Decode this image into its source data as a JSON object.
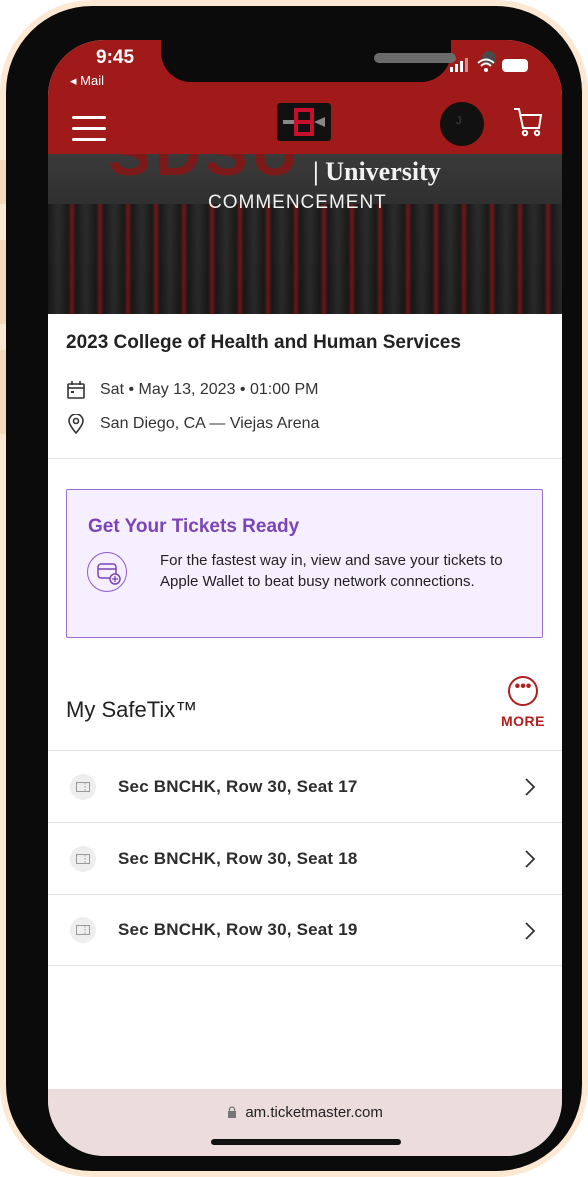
{
  "status": {
    "time": "9:45",
    "back_app": "◂ Mail"
  },
  "header": {
    "avatar_initial": "J"
  },
  "banner": {
    "big_text": "SDSU",
    "university": "| University",
    "commencement": "COMMENCEMENT"
  },
  "event": {
    "title": "2023 College of Health and Human Services",
    "date": "Sat • May 13, 2023 • 01:00 PM",
    "location": "San Diego, CA — Viejas Arena"
  },
  "promo": {
    "title": "Get Your Tickets Ready",
    "text": "For the fastest way in, view and save your tickets to Apple Wallet to beat busy network connections."
  },
  "safetix": {
    "title": "My SafeTix™",
    "more_label": "MORE",
    "tickets": [
      {
        "label": "Sec BNCHK, Row 30, Seat 17"
      },
      {
        "label": "Sec BNCHK, Row 30, Seat 18"
      },
      {
        "label": "Sec BNCHK, Row 30, Seat 19"
      }
    ]
  },
  "browser": {
    "url": "am.ticketmaster.com"
  },
  "colors": {
    "brand_red": "#a11a1a",
    "promo_purple": "#7a45b8",
    "promo_bg": "#f6efff",
    "more_red": "#b01e1e"
  }
}
